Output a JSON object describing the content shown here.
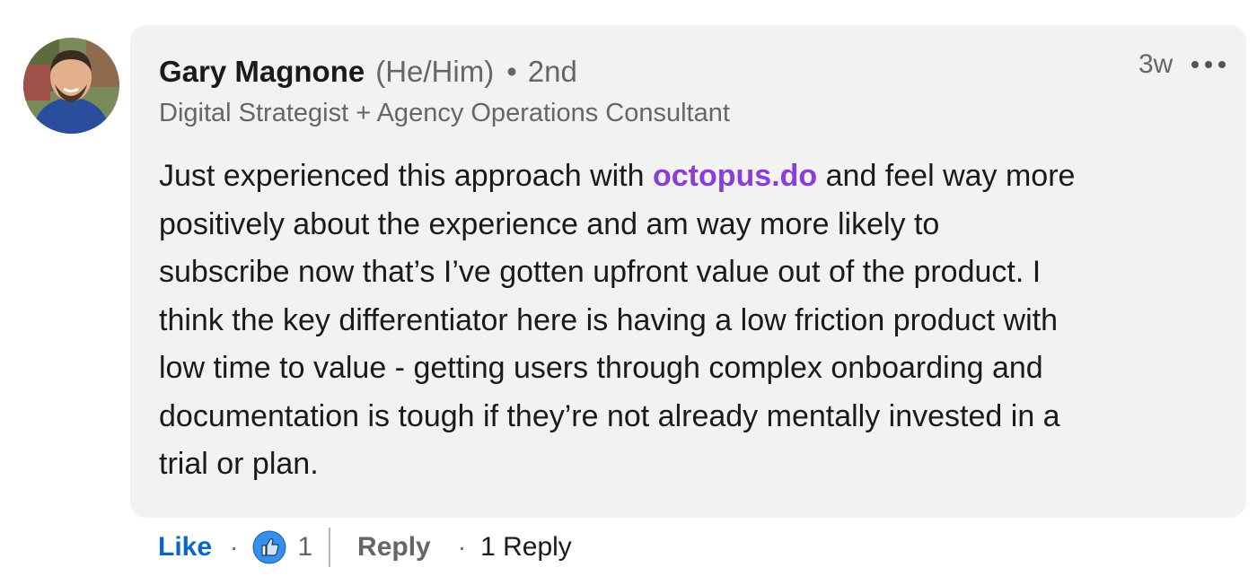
{
  "comment": {
    "author_name": "Gary Magnone",
    "pronouns": "(He/Him)",
    "separator": "•",
    "connection_degree": "2nd",
    "headline": "Digital Strategist + Agency Operations Consultant",
    "timestamp": "3w",
    "body": {
      "line1_before": "Just experienced this approach with ",
      "link_text": "octopus.do",
      "line1_after": " and feel way more",
      "line2": "positively about the experience and am way more likely to",
      "line3": "subscribe now that’s I’ve gotten upfront value out of the product. I",
      "line4": "think the key differentiator here is having a low friction product with",
      "line5": "low time to value - getting users through complex onboarding and",
      "line6": "documentation is tough if they’re not already mentally invested in a",
      "line7": "trial or plan."
    }
  },
  "actions": {
    "like_label": "Like",
    "dot": "·",
    "reaction_count": "1",
    "reply_label": "Reply",
    "reply_count_label": "1 Reply"
  },
  "icons": {
    "avatar": "avatar",
    "more": "more-options-icon",
    "reaction": "like-reaction-icon"
  },
  "colors": {
    "link": "#8a3ed9",
    "like": "#0a66c2",
    "bubble": "#f2f2f2",
    "reaction_blue": "#378fe9"
  }
}
